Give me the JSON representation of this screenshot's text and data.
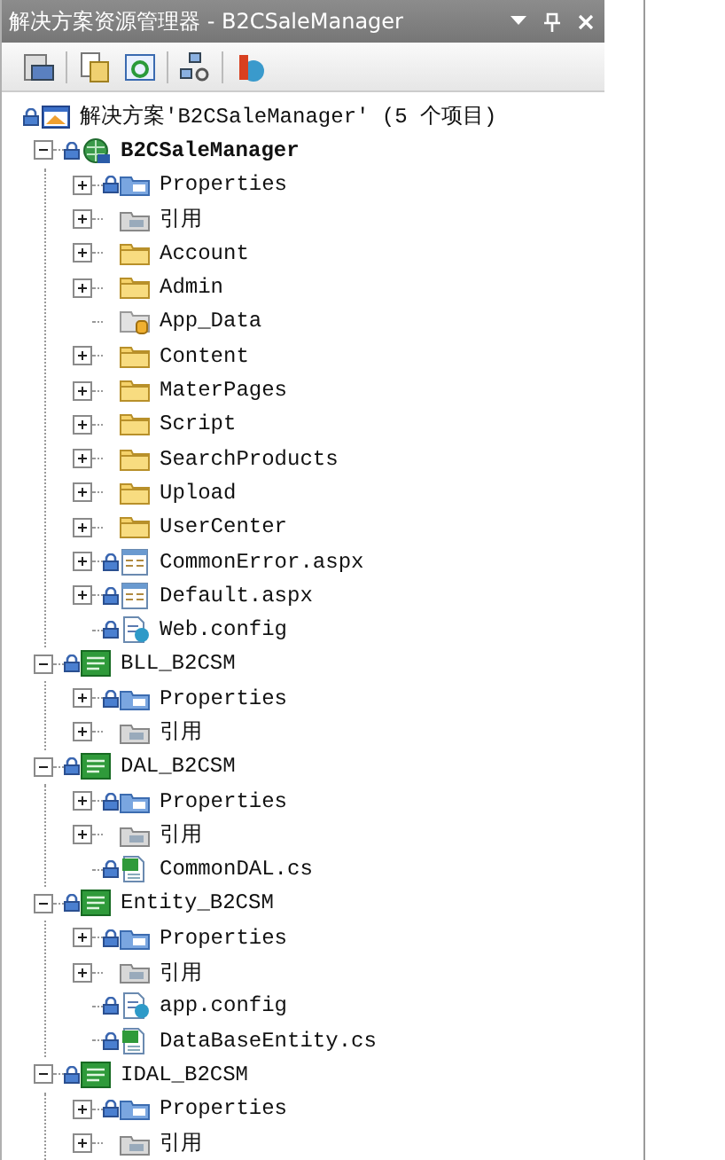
{
  "window": {
    "title": "解决方案资源管理器 - B2CSaleManager"
  },
  "tree": {
    "label": "解决方案'B2CSaleManager' (5 个项目)",
    "kind": "solution",
    "locked": true,
    "children": [
      {
        "label": "B2CSaleManager",
        "kind": "web-project",
        "locked": true,
        "startup": true,
        "expanded": true,
        "children": [
          {
            "label": "Properties",
            "kind": "properties",
            "locked": true,
            "expanded": false
          },
          {
            "label": "引用",
            "kind": "references",
            "locked": false,
            "expanded": false
          },
          {
            "label": "Account",
            "kind": "folder",
            "locked": false,
            "expanded": false
          },
          {
            "label": "Admin",
            "kind": "folder",
            "locked": false,
            "expanded": false
          },
          {
            "label": "App_Data",
            "kind": "data-folder",
            "locked": false
          },
          {
            "label": "Content",
            "kind": "folder",
            "locked": false,
            "expanded": false
          },
          {
            "label": "MaterPages",
            "kind": "folder",
            "locked": false,
            "expanded": false
          },
          {
            "label": "Script",
            "kind": "folder",
            "locked": false,
            "expanded": false
          },
          {
            "label": "SearchProducts",
            "kind": "folder",
            "locked": false,
            "expanded": false
          },
          {
            "label": "Upload",
            "kind": "folder",
            "locked": false,
            "expanded": false
          },
          {
            "label": "UserCenter",
            "kind": "folder",
            "locked": false,
            "expanded": false
          },
          {
            "label": "CommonError.aspx",
            "kind": "page",
            "locked": true,
            "expanded": false
          },
          {
            "label": "Default.aspx",
            "kind": "page",
            "locked": true,
            "expanded": false
          },
          {
            "label": "Web.config",
            "kind": "config",
            "locked": true
          }
        ]
      },
      {
        "label": "BLL_B2CSM",
        "kind": "cs-project",
        "locked": true,
        "startup": false,
        "expanded": true,
        "children": [
          {
            "label": "Properties",
            "kind": "properties",
            "locked": true,
            "expanded": false
          },
          {
            "label": "引用",
            "kind": "references",
            "locked": false,
            "expanded": false
          }
        ]
      },
      {
        "label": "DAL_B2CSM",
        "kind": "cs-project",
        "locked": true,
        "startup": false,
        "expanded": true,
        "children": [
          {
            "label": "Properties",
            "kind": "properties",
            "locked": true,
            "expanded": false
          },
          {
            "label": "引用",
            "kind": "references",
            "locked": false,
            "expanded": false
          },
          {
            "label": "CommonDAL.cs",
            "kind": "cs-file",
            "locked": true
          }
        ]
      },
      {
        "label": "Entity_B2CSM",
        "kind": "cs-project",
        "locked": true,
        "startup": false,
        "expanded": true,
        "children": [
          {
            "label": "Properties",
            "kind": "properties",
            "locked": true,
            "expanded": false
          },
          {
            "label": "引用",
            "kind": "references",
            "locked": false,
            "expanded": false
          },
          {
            "label": "app.config",
            "kind": "config",
            "locked": true
          },
          {
            "label": "DataBaseEntity.cs",
            "kind": "cs-file",
            "locked": true
          }
        ]
      },
      {
        "label": "IDAL_B2CSM",
        "kind": "cs-project",
        "locked": true,
        "startup": false,
        "expanded": true,
        "children": [
          {
            "label": "Properties",
            "kind": "properties",
            "locked": true,
            "expanded": false
          },
          {
            "label": "引用",
            "kind": "references",
            "locked": false,
            "expanded": false
          }
        ]
      }
    ]
  }
}
